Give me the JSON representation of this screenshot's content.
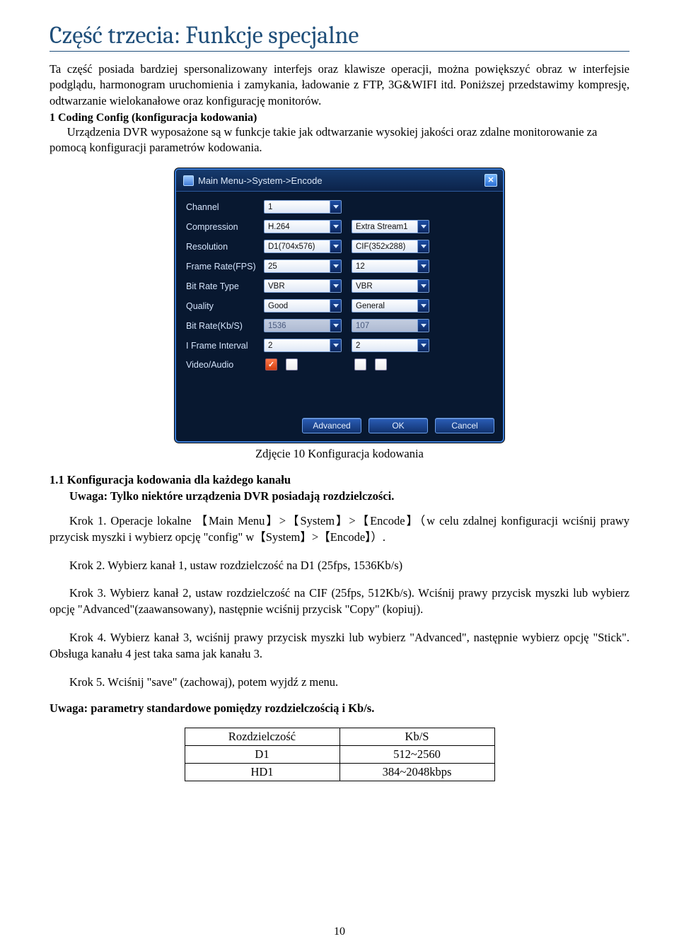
{
  "title": "Część trzecia: Funkcje specjalne",
  "para1": "Ta część posiada bardziej spersonalizowany interfejs oraz klawisze operacji, można powiększyć obraz w interfejsie podglądu, harmonogram uruchomienia i zamykania, ładowanie z FTP, 3G&WIFI itd. Poniższej przedstawimy kompresję, odtwarzanie wielokanałowe oraz konfigurację monitorów.",
  "sec1_head": "1 Coding Config (konfiguracja kodowania)",
  "sec1_body_line": "Urządzenia DVR wyposażone są w funkcje takie jak odtwarzanie wysokiej jakości oraz zdalne monitorowanie za pomocą konfiguracji parametrów kodowania.",
  "dvr": {
    "title": "Main Menu->System->Encode",
    "labels": {
      "channel": "Channel",
      "compression": "Compression",
      "resolution": "Resolution",
      "fps": "Frame Rate(FPS)",
      "brtype": "Bit Rate Type",
      "quality": "Quality",
      "brkbs": "Bit Rate(Kb/S)",
      "iframe": "I Frame Interval",
      "va": "Video/Audio"
    },
    "values": {
      "channel": "1",
      "compression": "H.264",
      "extra": "Extra Stream1",
      "resolution": "D1(704x576)",
      "resolution2": "CIF(352x288)",
      "fps": "25",
      "fps2": "12",
      "brtype": "VBR",
      "brtype2": "VBR",
      "quality": "Good",
      "quality2": "General",
      "brkbs": "1536",
      "brkbs2": "107",
      "iframe": "2",
      "iframe2": "2"
    },
    "buttons": {
      "adv": "Advanced",
      "ok": "OK",
      "cancel": "Cancel"
    }
  },
  "caption": "Zdjęcie 10 Konfiguracja kodowania",
  "h11": "1.1 Konfiguracja kodowania dla każdego kanału",
  "uwaga1": "Uwaga: Tylko niektóre urządzenia DVR posiadają rozdzielczości.",
  "krok1": "Krok 1. Operacje lokalne 【Main Menu】>【System】>【Encode】（w celu zdalnej konfiguracji wciśnij prawy przycisk myszki i wybierz opcję \"config\" w【System】>【Encode】）.",
  "krok2": "Krok 2. Wybierz kanał 1, ustaw rozdzielczość na D1 (25fps, 1536Kb/s)",
  "krok3": "Krok 3. Wybierz kanał 2, ustaw rozdzielczość na CIF (25fps, 512Kb/s). Wciśnij prawy przycisk myszki lub wybierz opcję \"Advanced\"(zaawansowany), następnie wciśnij przycisk \"Copy\" (kopiuj).",
  "krok4": "Krok 4. Wybierz kanał 3, wciśnij prawy przycisk myszki lub wybierz \"Advanced\", następnie wybierz opcję \"Stick\". Obsługa kanału 4 jest taka sama jak kanału 3.",
  "krok5": "Krok 5. Wciśnij \"save\" (zachowaj), potem wyjdź z menu.",
  "uwaga2": "Uwaga: parametry standardowe pomiędzy rozdzielczością i Kb/s.",
  "table": {
    "h1": "Rozdzielczość",
    "h2": "Kb/S",
    "r1a": "D1",
    "r1b": "512~2560",
    "r2a": "HD1",
    "r2b": "384~2048kbps"
  },
  "pagenum": "10"
}
